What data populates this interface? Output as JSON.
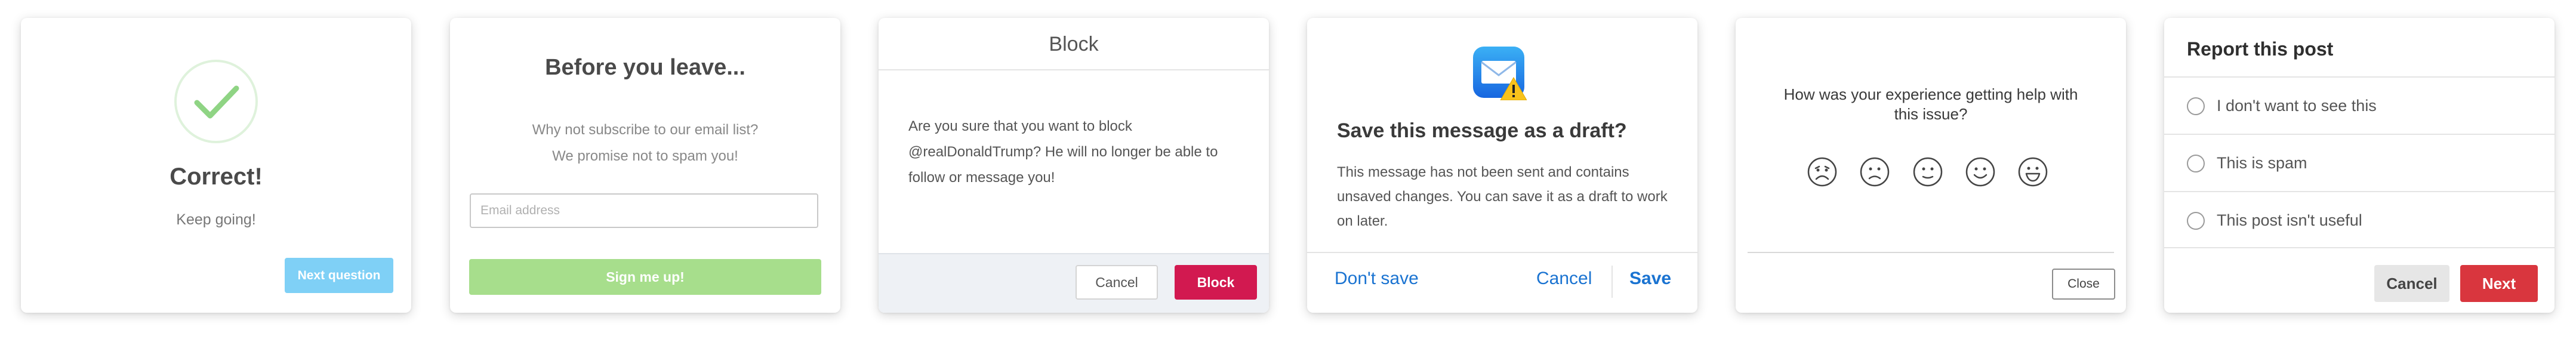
{
  "correct_dialog": {
    "icon": "checkmark-icon",
    "title": "Correct!",
    "subtitle": "Keep going!",
    "next_button": "Next question",
    "accent_color": "#7fd0f6",
    "check_color": "#8fd484"
  },
  "subscribe_dialog": {
    "title": "Before you leave...",
    "line1": "Why not subscribe to our email list?",
    "line2": "We promise not to spam you!",
    "email_placeholder": "Email address",
    "submit_button": "Sign me up!",
    "accent_color": "#a7de8c"
  },
  "block_dialog": {
    "title": "Block",
    "message": "Are you sure that you want to block @realDonaldTrump? He will no longer be able to follow or message you!",
    "cancel_button": "Cancel",
    "block_button": "Block",
    "accent_color": "#d21950"
  },
  "draft_dialog": {
    "icon": "mail-warning-icon",
    "title": "Save this message as a draft?",
    "message": "This message has not been sent and contains unsaved changes. You can save it as a draft to work on later.",
    "dont_save_button": "Don't save",
    "cancel_button": "Cancel",
    "save_button": "Save",
    "link_color": "#1a73d1"
  },
  "feedback_dialog": {
    "question": "How was your experience getting help with this issue?",
    "faces": [
      "very-sad-face-icon",
      "sad-face-icon",
      "neutral-face-icon",
      "happy-face-icon",
      "very-happy-face-icon"
    ],
    "close_button": "Close"
  },
  "report_dialog": {
    "title": "Report this post",
    "options": [
      {
        "label": "I don't want to see this"
      },
      {
        "label": "This is spam"
      },
      {
        "label": "This post isn't useful"
      }
    ],
    "cancel_button": "Cancel",
    "next_button": "Next",
    "accent_color": "#d9363e"
  }
}
